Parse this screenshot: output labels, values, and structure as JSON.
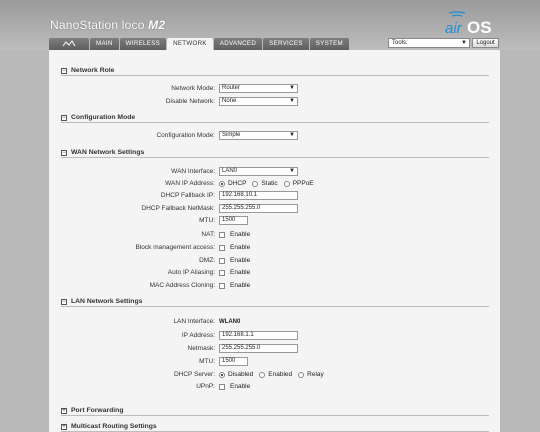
{
  "header": {
    "device_name": "NanoStation loco",
    "device_model": "M2",
    "brand_logo": "airOS",
    "brand_color": "#1a8fd6"
  },
  "tabs": [
    {
      "label": "MAIN",
      "active": false
    },
    {
      "label": "WIRELESS",
      "active": false
    },
    {
      "label": "NETWORK",
      "active": true
    },
    {
      "label": "ADVANCED",
      "active": false
    },
    {
      "label": "SERVICES",
      "active": false
    },
    {
      "label": "SYSTEM",
      "active": false
    }
  ],
  "tab_logo_icon": "ubiquiti-logo-icon",
  "tools": {
    "value": "Tools:",
    "logout_label": "Logout"
  },
  "network_role": {
    "title": "Network Role",
    "toggle": "−",
    "network_mode_label": "Network Mode:",
    "network_mode_value": "Router",
    "disable_network_label": "Disable Network:",
    "disable_network_value": "None"
  },
  "configuration_mode": {
    "title": "Configuration Mode",
    "toggle": "−",
    "label": "Configuration Mode:",
    "value": "Simple"
  },
  "wan": {
    "title": "WAN Network Settings",
    "toggle": "−",
    "interface_label": "WAN Interface:",
    "interface_value": "LAN0",
    "ip_address_label": "WAN IP Address:",
    "ip_options": [
      "DHCP",
      "Static",
      "PPPoE"
    ],
    "ip_selected": "DHCP",
    "fallback_ip_label": "DHCP Fallback IP:",
    "fallback_ip_value": "192.168.10.1",
    "fallback_netmask_label": "DHCP Fallback NetMask:",
    "fallback_netmask_value": "255.255.255.0",
    "mtu_label": "MTU:",
    "mtu_value": "1500",
    "nat_label": "NAT:",
    "block_mgmt_label": "Block management access:",
    "dmz_label": "DMZ:",
    "auto_ip_label": "Auto IP Aliasing:",
    "mac_cloning_label": "MAC Address Cloning:",
    "enable_label": "Enable"
  },
  "lan": {
    "title": "LAN Network Settings",
    "toggle": "−",
    "interface_label": "LAN Interface:",
    "interface_value": "WLAN0",
    "ip_label": "IP Address:",
    "ip_value": "192.168.1.1",
    "netmask_label": "Netmask:",
    "netmask_value": "255.255.255.0",
    "mtu_label": "MTU:",
    "mtu_value": "1500",
    "dhcp_server_label": "DHCP Server:",
    "dhcp_options": [
      "Disabled",
      "Enabled",
      "Relay"
    ],
    "dhcp_selected": "Disabled",
    "upnp_label": "UPnP:",
    "enable_label": "Enable"
  },
  "port_forwarding": {
    "title": "Port Forwarding",
    "toggle": "+"
  },
  "multicast": {
    "title": "Multicast Routing Settings",
    "toggle": "+"
  }
}
